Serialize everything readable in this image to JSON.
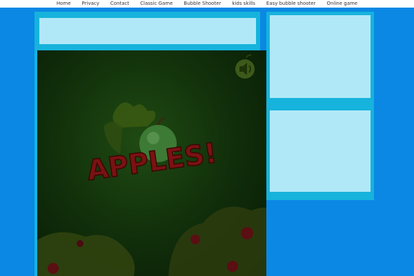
{
  "nav": {
    "items": [
      {
        "label": "Home"
      },
      {
        "label": "Privacy"
      },
      {
        "label": "Contact"
      },
      {
        "label": "Classic Game"
      },
      {
        "label": "Bubble Shooter"
      },
      {
        "label": "kids skills"
      },
      {
        "label": "Easy bubble shooter"
      },
      {
        "label": "Online game"
      }
    ]
  },
  "game": {
    "logo_text": "APPLES!",
    "sound_icon": "speaker-icon"
  },
  "colors": {
    "page_bg": "#0a88e4",
    "panel_border": "#16b3dc",
    "panel_fill": "#b1e8f8",
    "game_bg": "#102d0a"
  }
}
